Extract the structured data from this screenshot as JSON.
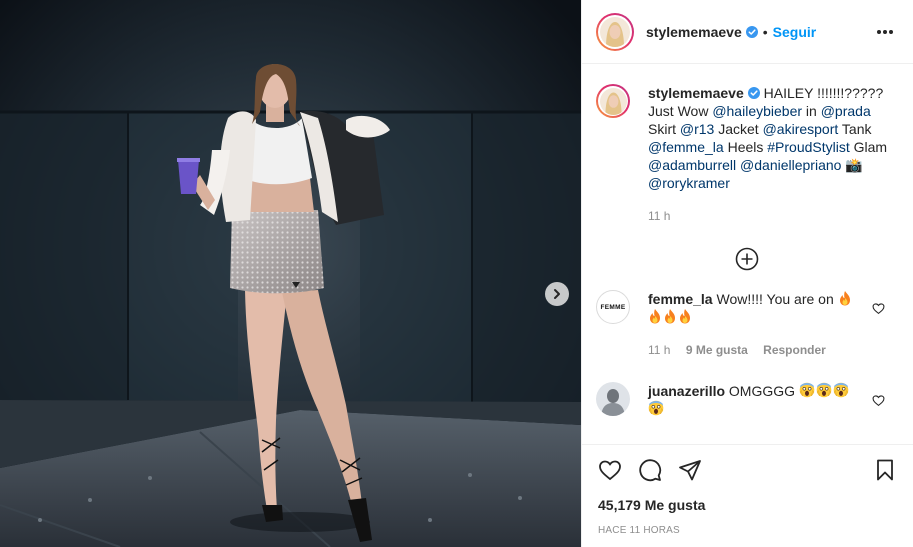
{
  "post": {
    "author": "stylememaeve",
    "follow_label": "Seguir",
    "separator": "•"
  },
  "caption": {
    "author": "stylememaeve",
    "parts": [
      {
        "t": "text",
        "v": "HAILEY !!!!!!!????? Just Wow "
      },
      {
        "t": "link",
        "v": "@haileybieber"
      },
      {
        "t": "text",
        "v": " in "
      },
      {
        "t": "link",
        "v": "@prada"
      },
      {
        "t": "text",
        "v": " Skirt "
      },
      {
        "t": "link",
        "v": "@r13"
      },
      {
        "t": "text",
        "v": " Jacket "
      },
      {
        "t": "link",
        "v": "@akiresport"
      },
      {
        "t": "text",
        "v": " Tank "
      },
      {
        "t": "link",
        "v": "@femme_la"
      },
      {
        "t": "text",
        "v": " Heels "
      },
      {
        "t": "link",
        "v": "#ProudStylist"
      },
      {
        "t": "text",
        "v": " Glam "
      },
      {
        "t": "link",
        "v": "@adamburrell"
      },
      {
        "t": "text",
        "v": " "
      },
      {
        "t": "link",
        "v": "@daniellepriano"
      },
      {
        "t": "text",
        "v": " 📸 "
      },
      {
        "t": "link",
        "v": "@rorykramer"
      }
    ],
    "time": "11 h"
  },
  "comments": [
    {
      "author": "femme_la",
      "avatar_text": "FEMME",
      "text": "Wow!!!! You are on",
      "emoji_count": 4,
      "emoji": "fire",
      "time": "11 h",
      "likes": "9 Me gusta",
      "reply_label": "Responder"
    },
    {
      "author": "juanazerillo",
      "text": "OMGGGG",
      "emoji_count": 4,
      "emoji": "screaming-face"
    }
  ],
  "footer": {
    "likes": "45,179 Me gusta",
    "timestamp": "Hace 11 horas"
  },
  "colors": {
    "accent": "#0095f6",
    "link": "#00376b",
    "verified": "#3897f0",
    "muted": "#8e8e8e"
  }
}
